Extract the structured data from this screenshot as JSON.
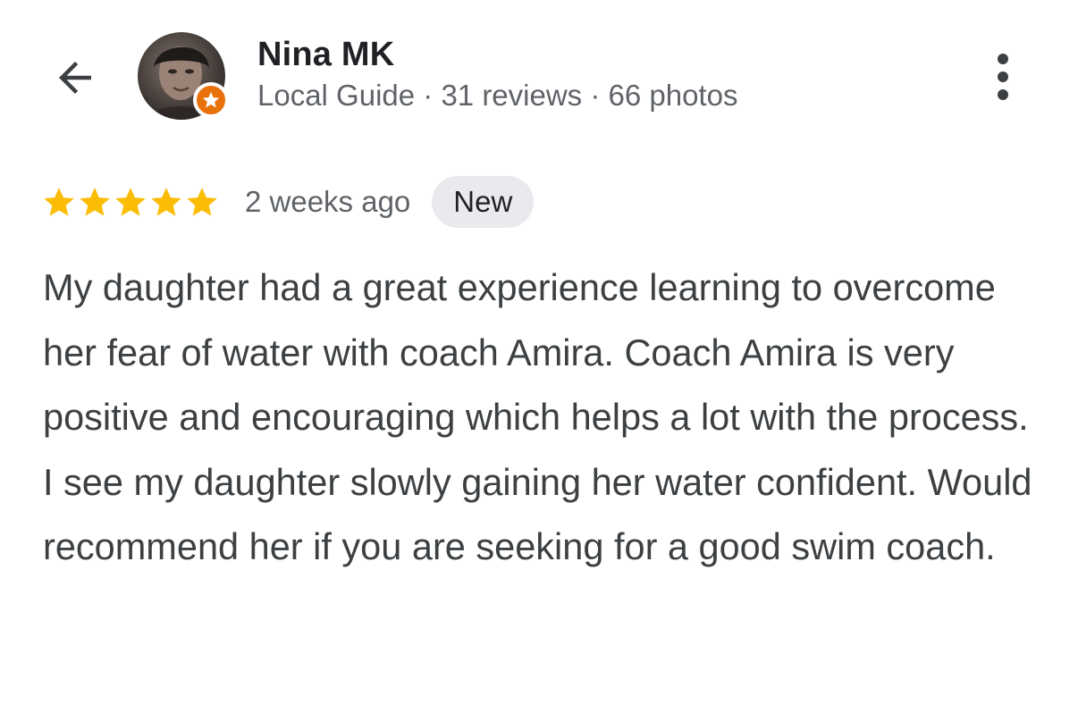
{
  "header": {
    "back_icon": "arrow-left-icon",
    "reviewer_name": "Nina MK",
    "reviewer_meta": "Local Guide · 31 reviews · 66 photos",
    "local_guide_badge_color": "#e8710a",
    "more_icon": "more-vertical-icon"
  },
  "review": {
    "rating": 5,
    "rating_max": 5,
    "star_color": "#fbbc04",
    "time_ago": "2 weeks ago",
    "badge_label": "New",
    "text": "My daughter had a great experience learning to overcome her fear of water with coach Amira. Coach Amira is very positive and encouraging which helps a lot with the process. I see my daughter slowly gaining her water confident. Would recommend her if you are seeking for a good swim coach."
  }
}
